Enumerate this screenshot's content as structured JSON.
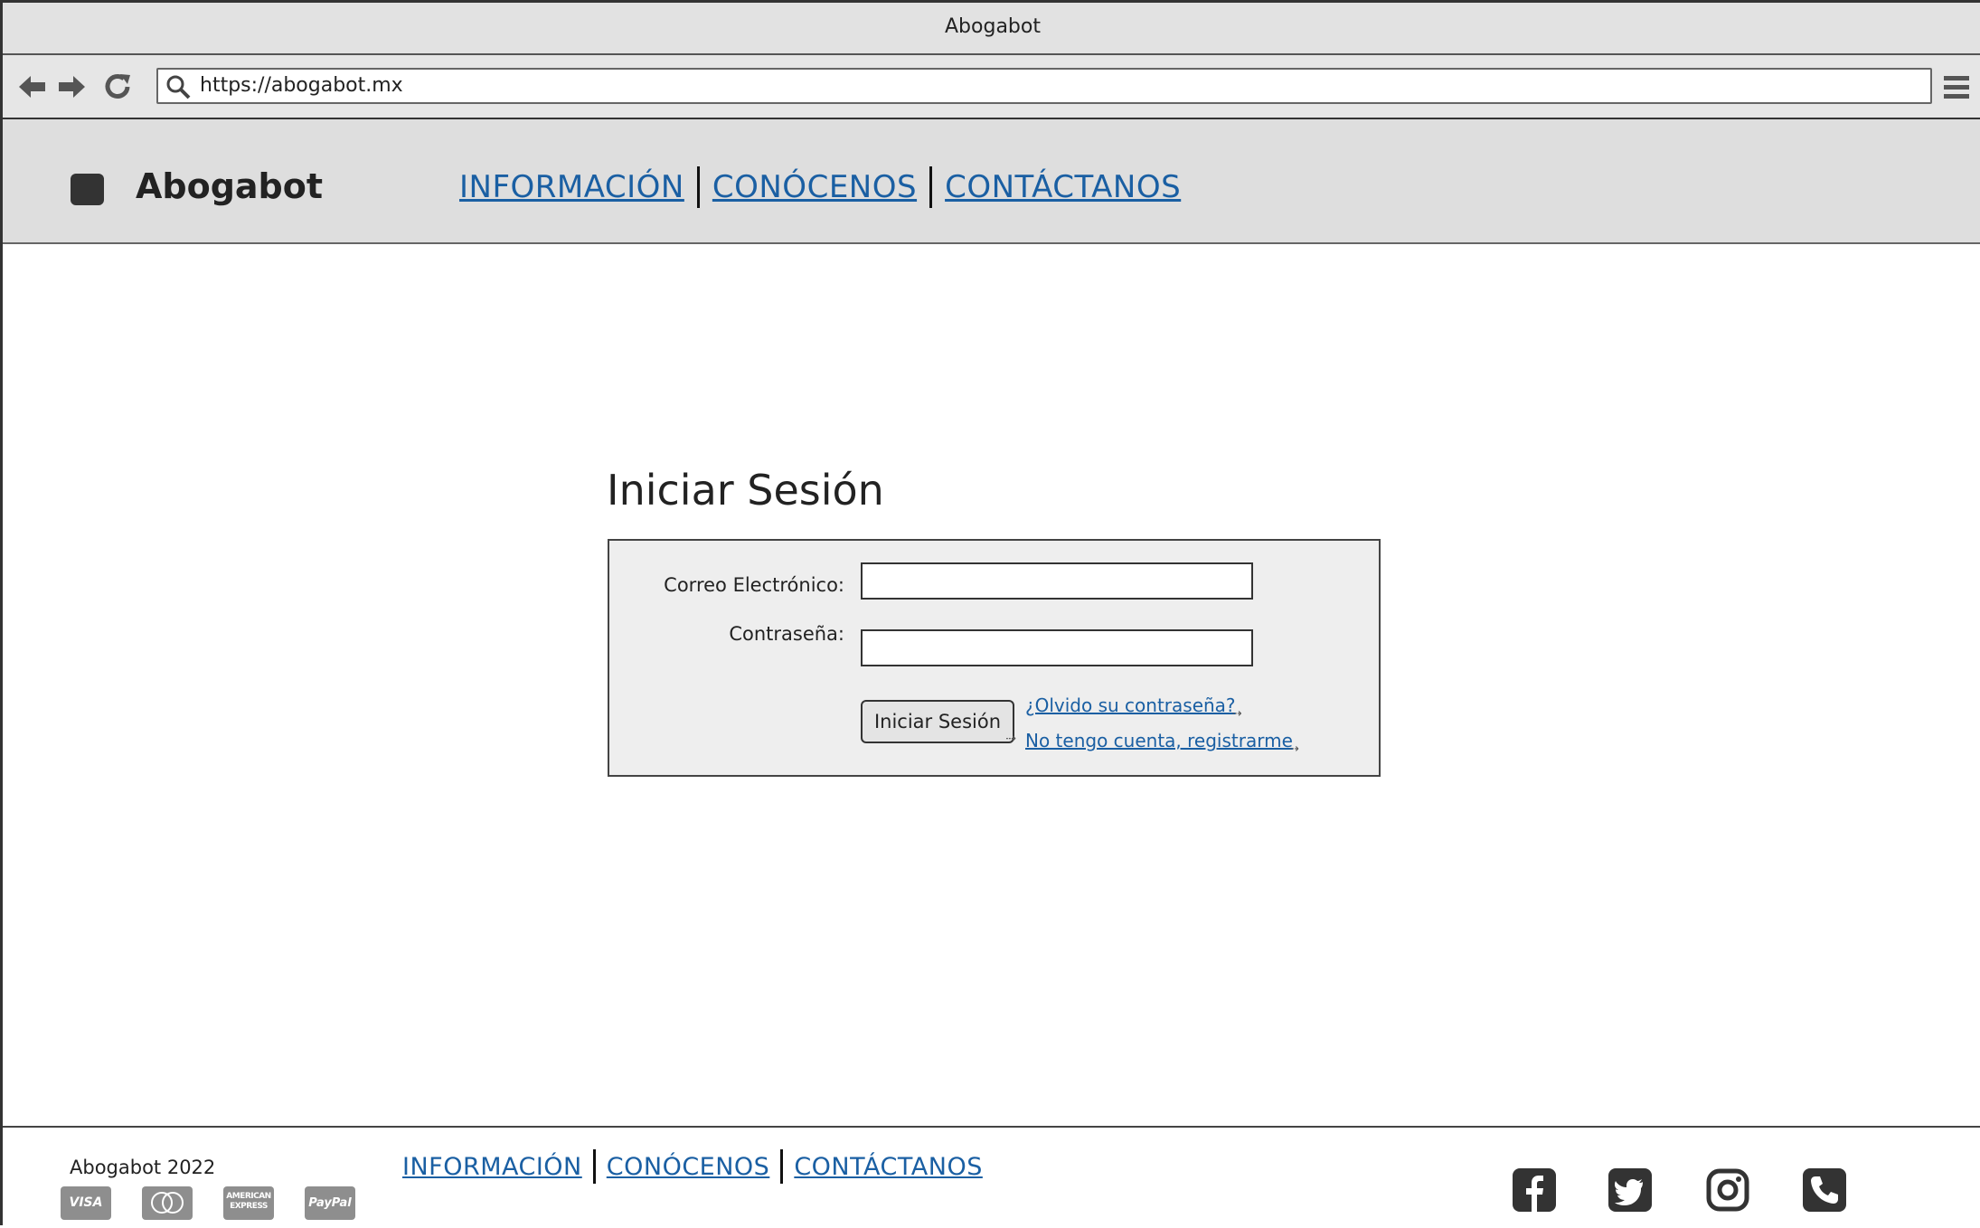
{
  "window": {
    "title": "Abogabot"
  },
  "browser": {
    "url": "https://abogabot.mx",
    "icons": [
      "back-arrow-icon",
      "forward-arrow-icon",
      "reload-icon",
      "search-icon",
      "hamburger-menu-icon"
    ]
  },
  "header": {
    "brand": "Abogabot",
    "nav": [
      {
        "label": "INFORMACIÓN"
      },
      {
        "label": "CONÓCENOS"
      },
      {
        "label": "CONTÁCTANOS"
      }
    ]
  },
  "main": {
    "title": "Iniciar Sesión",
    "form": {
      "email_label": "Correo Electrónico:",
      "email_value": "",
      "password_label": "Contraseña:",
      "password_value": "",
      "submit_label": "Iniciar Sesión",
      "forgot_link": "¿Olvido su contraseña?",
      "register_link": "No tengo cuenta, registrarme"
    }
  },
  "footer": {
    "copyright": "Abogabot 2022",
    "payments": [
      "VISA",
      "mastercard",
      "AMERICAN EXPRESS",
      "PayPal"
    ],
    "nav": [
      {
        "label": "INFORMACIÓN"
      },
      {
        "label": "CONÓCENOS"
      },
      {
        "label": "CONTÁCTANOS"
      }
    ],
    "social_icons": [
      "facebook-icon",
      "twitter-icon",
      "instagram-icon",
      "phone-icon"
    ]
  },
  "colors": {
    "link": "#1a5fa3",
    "header_bg": "#dedede",
    "form_bg": "#eeeeee"
  }
}
